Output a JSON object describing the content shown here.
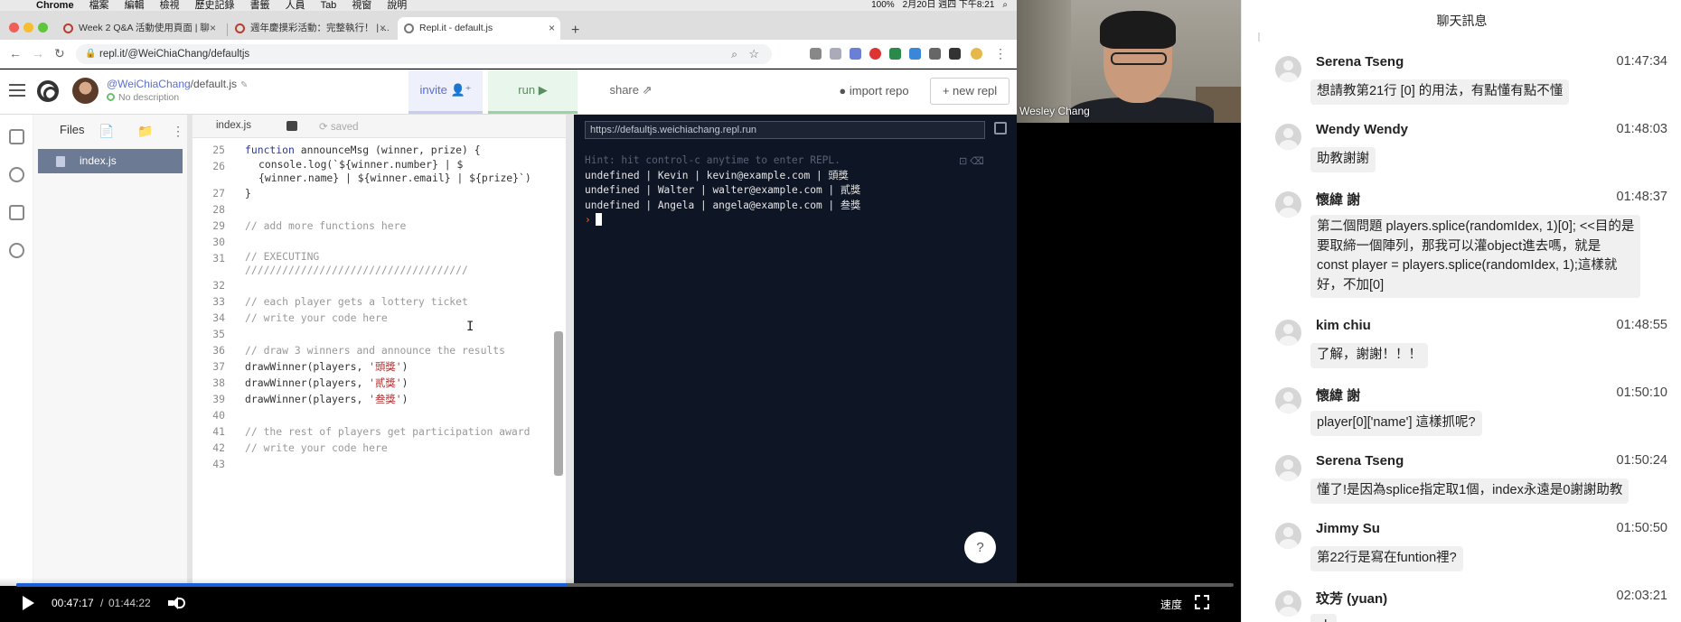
{
  "menubar": {
    "items": [
      "Chrome",
      "檔案",
      "編輯",
      "檢視",
      "歷史記錄",
      "書籤",
      "人員",
      "Tab",
      "視窗",
      "說明"
    ],
    "battery": "100%",
    "datetime": "2月20日 週四 下午8:21"
  },
  "browser": {
    "tabs": [
      {
        "label": "Week 2 Q&A 活動使用頁面 | 聊",
        "active": false
      },
      {
        "label": "週年慶摸彩活動：完整執行！ | ...",
        "active": false
      },
      {
        "label": "Repl.it - default.js",
        "active": true
      }
    ],
    "address": "repl.it/@WeiChiaChang/defaultjs"
  },
  "repl": {
    "owner": "@WeiChiaChang",
    "filename": "/default.js",
    "description": "No description",
    "invite_label": "invite",
    "run_label": "run ▶",
    "share_label": "share",
    "import_label": "import repo",
    "new_label": "+ new repl",
    "files_label": "Files",
    "file_item": "index.js",
    "editor_tab": "index.js",
    "saved_label": "saved",
    "code_lines": [
      {
        "n": "25",
        "t": "function announceMsg (winner, prize) {"
      },
      {
        "n": "26",
        "t": "console.log(`${winner.number} | $\n{winner.name} | ${winner.email} | ${prize}`)"
      },
      {
        "n": "27",
        "t": "}"
      },
      {
        "n": "28",
        "t": ""
      },
      {
        "n": "29",
        "t": "// add more functions here"
      },
      {
        "n": "30",
        "t": ""
      },
      {
        "n": "31",
        "t": "// EXECUTING\n////////////////////////////////////"
      },
      {
        "n": "32",
        "t": ""
      },
      {
        "n": "33",
        "t": "// each player gets a lottery ticket"
      },
      {
        "n": "34",
        "t": "// write your code here"
      },
      {
        "n": "35",
        "t": ""
      },
      {
        "n": "36",
        "t": "// draw 3 winners and announce the results"
      },
      {
        "n": "37",
        "t": "drawWinner(players, '頭獎')"
      },
      {
        "n": "38",
        "t": "drawWinner(players, '貳獎')"
      },
      {
        "n": "39",
        "t": "drawWinner(players, '叁獎')"
      },
      {
        "n": "40",
        "t": ""
      },
      {
        "n": "41",
        "t": "// the rest of players get participation award"
      },
      {
        "n": "42",
        "t": "// write your code here"
      },
      {
        "n": "43",
        "t": ""
      }
    ],
    "console_url": "https://defaultjs.weichiachang.repl.run",
    "console_hint": "Hint: hit control-c anytime to enter REPL.",
    "console_lines": [
      "undefined | Kevin | kevin@example.com | 頭獎",
      "undefined | Walter | walter@example.com | 貳獎",
      "undefined | Angela | angela@example.com | 叁獎"
    ],
    "prompt": "›",
    "help_label": "?"
  },
  "webcam": {
    "name": "Wesley Chang"
  },
  "player": {
    "current_time": "00:47:17",
    "separator": "/",
    "total_time": "01:44:22",
    "progress": 0.453,
    "speed_label": "速度"
  },
  "chat": {
    "title": "聊天訊息",
    "messages": [
      {
        "name": "Serena Tseng",
        "time": "01:47:34",
        "lines": [
          "想請教第21行 [0] 的用法，有點懂有點不懂"
        ]
      },
      {
        "name": "Wendy Wendy",
        "time": "01:48:03",
        "lines": [
          "助教謝謝"
        ]
      },
      {
        "name": "懷緯 謝",
        "time": "01:48:37",
        "lines": [
          "第二個問題 players.splice(randomIdex, 1)[0]; <<目的是",
          "要取締一個陣列，那我可以灌object進去嗎，就是",
          "const player = players.splice(randomIdex, 1);這樣就",
          "好，不加[0]"
        ]
      },
      {
        "name": "kim chiu",
        "time": "01:48:55",
        "lines": [
          "了解，謝謝！！！"
        ]
      },
      {
        "name": "懷緯 謝",
        "time": "01:50:10",
        "lines": [
          "player[0]['name'] 這樣抓呢?"
        ]
      },
      {
        "name": "Serena Tseng",
        "time": "01:50:24",
        "lines": [
          "懂了!是因為splice指定取1個，index永遠是0謝謝助教"
        ]
      },
      {
        "name": "Jimmy Su",
        "time": "01:50:50",
        "lines": [
          "第22行是寫在funtion裡?"
        ]
      },
      {
        "name": "玟芳 (yuan)",
        "time": "02:03:21",
        "lines": [
          "ok"
        ]
      }
    ]
  },
  "colors": {
    "console_bg": "#0e1525",
    "accent_blue": "#1a5fd9",
    "run_green": "#5a8d60",
    "invite_blue": "#5a6fd0"
  }
}
